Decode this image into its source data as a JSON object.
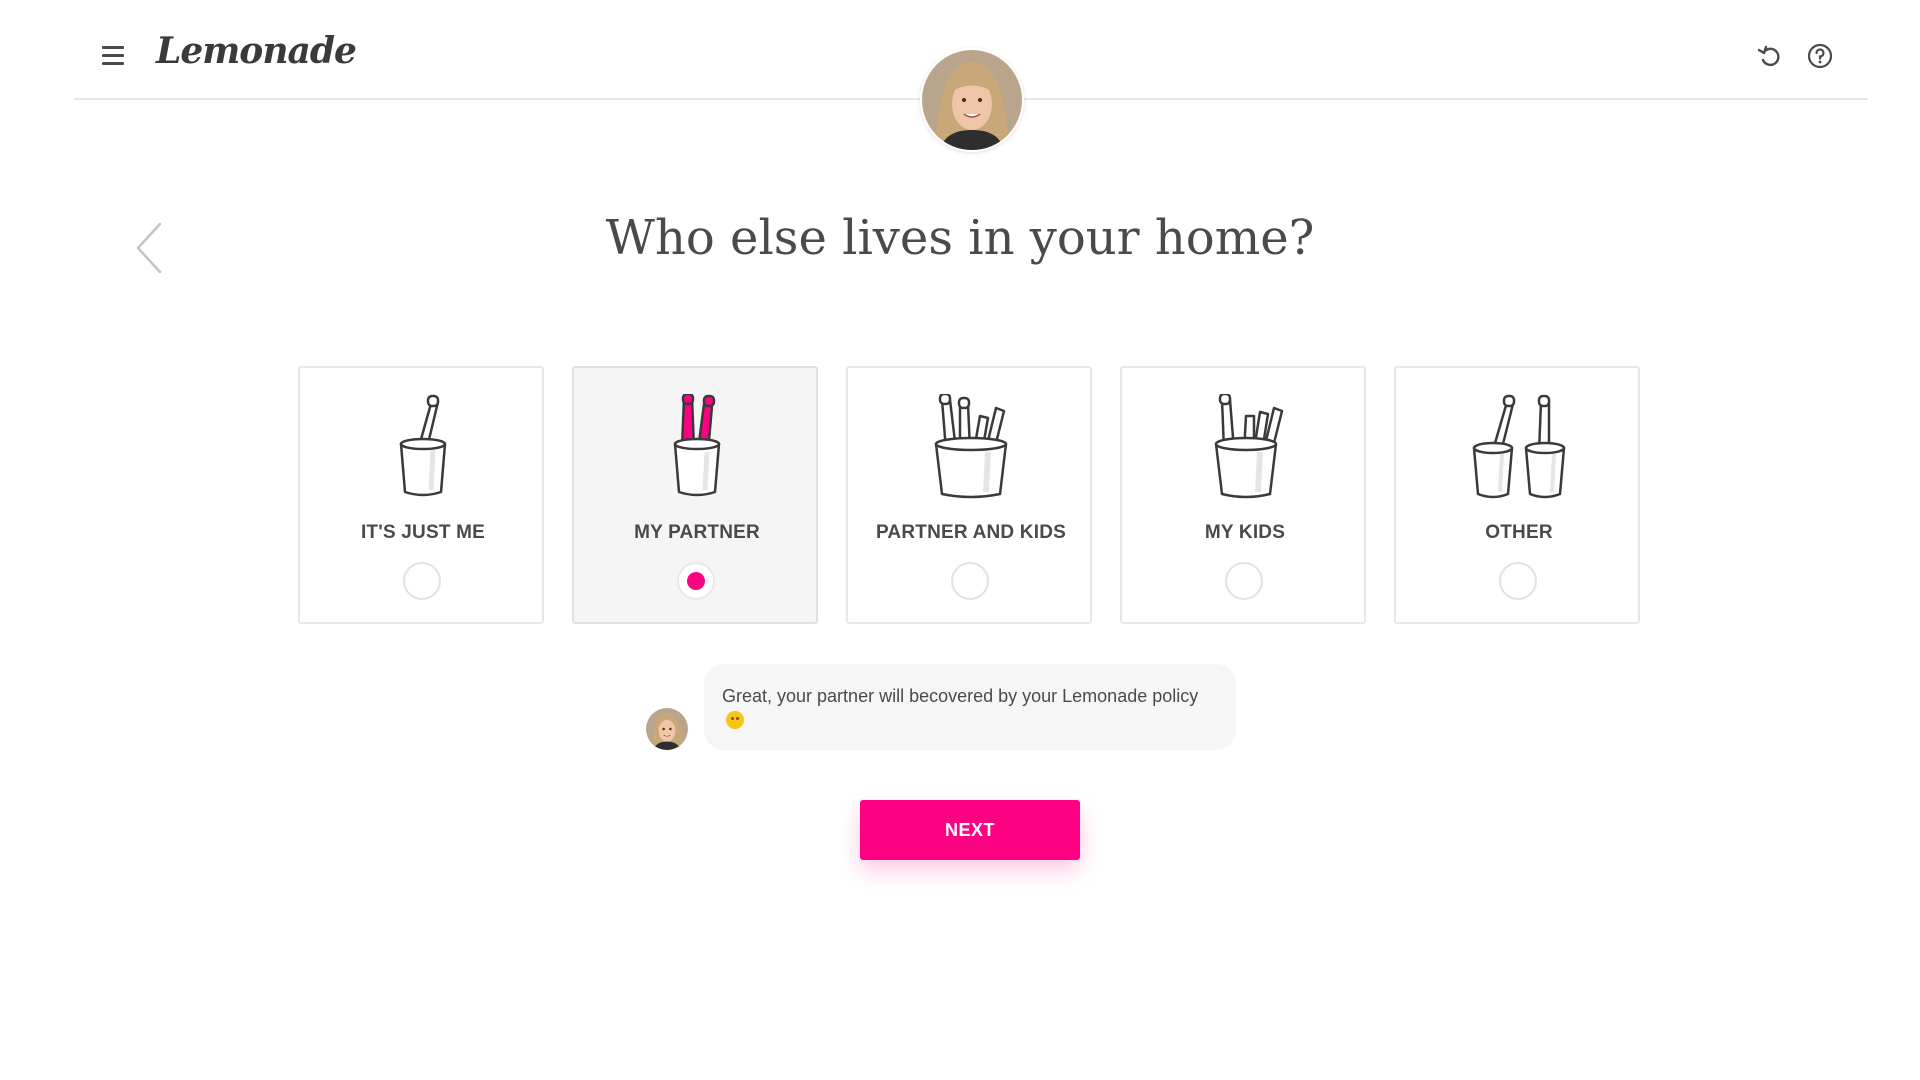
{
  "header": {
    "logo_text": "Lemonade",
    "menu_icon": "hamburger-menu-icon",
    "undo_icon": "undo-icon",
    "help_icon": "help-circle-icon"
  },
  "question": {
    "title": "Who else lives in your home?",
    "back_icon": "chevron-left-icon"
  },
  "options": [
    {
      "label": "IT'S JUST ME",
      "selected": false,
      "icon": "single-toothbrush-cup-icon"
    },
    {
      "label": "MY PARTNER",
      "selected": true,
      "icon": "two-toothbrushes-cup-icon"
    },
    {
      "label": "PARTNER AND KIDS",
      "selected": false,
      "icon": "family-toothbrushes-cup-icon"
    },
    {
      "label": "MY KIDS",
      "selected": false,
      "icon": "kids-toothbrushes-cup-icon"
    },
    {
      "label": "OTHER",
      "selected": false,
      "icon": "two-toothbrush-cups-icon"
    }
  ],
  "chat": {
    "message": "Great, your partner will becovered by your Lemonade policy"
  },
  "next_button": {
    "label": "NEXT"
  },
  "colors": {
    "accent": "#ff0083",
    "text": "#4a4a4a",
    "card_border": "#e8e8e8",
    "selected_card_bg": "#f5f5f5"
  }
}
